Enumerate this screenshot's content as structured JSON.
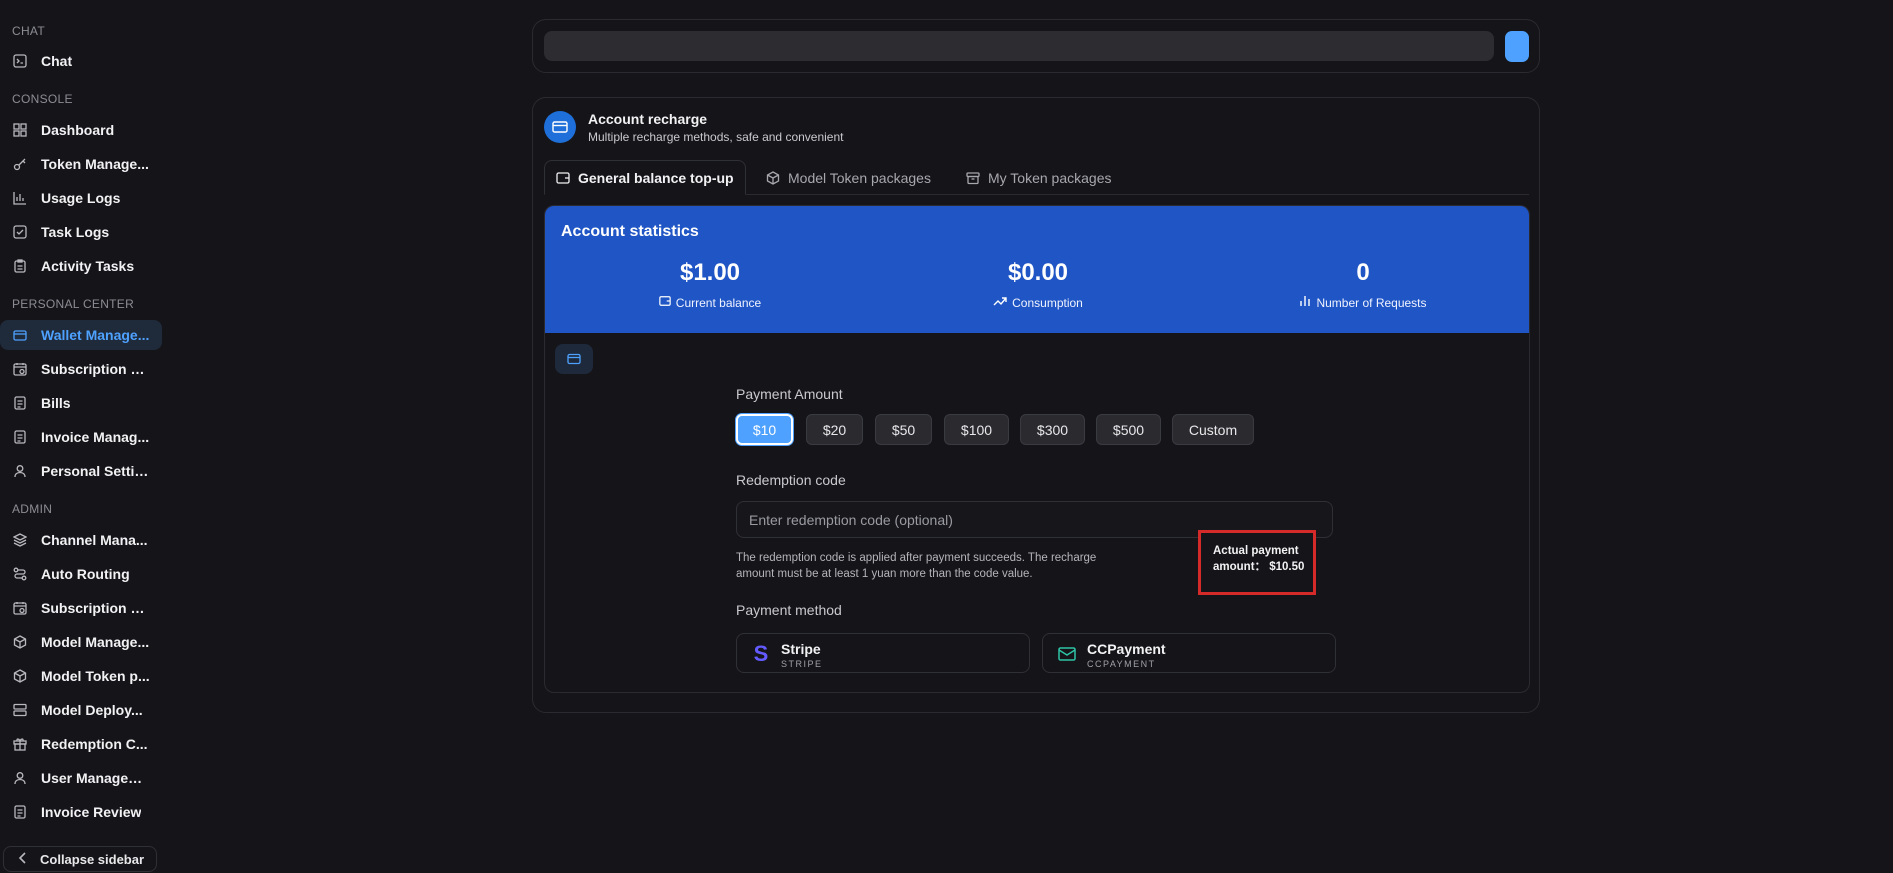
{
  "sidebar": {
    "sections": [
      {
        "title": "CHAT",
        "items": [
          {
            "label": "Chat",
            "icon": "terminal-icon"
          }
        ]
      },
      {
        "title": "CONSOLE",
        "items": [
          {
            "label": "Dashboard",
            "icon": "dashboard-icon"
          },
          {
            "label": "Token Manage...",
            "icon": "key-icon"
          },
          {
            "label": "Usage Logs",
            "icon": "bar-chart-icon"
          },
          {
            "label": "Task Logs",
            "icon": "check-square-icon"
          },
          {
            "label": "Activity Tasks",
            "icon": "clipboard-icon"
          }
        ]
      },
      {
        "title": "PERSONAL CENTER",
        "items": [
          {
            "label": "Wallet Manage...",
            "icon": "credit-card-icon",
            "active": true
          },
          {
            "label": "Subscription Pl...",
            "icon": "calendar-clock-icon"
          },
          {
            "label": "Bills",
            "icon": "document-icon"
          },
          {
            "label": "Invoice Manag...",
            "icon": "document-icon"
          },
          {
            "label": "Personal Settin...",
            "icon": "user-icon"
          }
        ]
      },
      {
        "title": "ADMIN",
        "items": [
          {
            "label": "Channel Mana...",
            "icon": "layers-icon"
          },
          {
            "label": "Auto Routing",
            "icon": "route-icon"
          },
          {
            "label": "Subscription M...",
            "icon": "calendar-clock-icon"
          },
          {
            "label": "Model Manage...",
            "icon": "cube-icon"
          },
          {
            "label": "Model Token p...",
            "icon": "cube-icon"
          },
          {
            "label": "Model Deploy...",
            "icon": "server-icon"
          },
          {
            "label": "Redemption C...",
            "icon": "gift-icon"
          },
          {
            "label": "User Managem...",
            "icon": "user-icon"
          },
          {
            "label": "Invoice Review",
            "icon": "document-icon"
          }
        ]
      }
    ],
    "collapse_label": "Collapse sidebar"
  },
  "recharge": {
    "title": "Account recharge",
    "subtitle": "Multiple recharge methods, safe and convenient",
    "tabs": [
      {
        "label": "General balance top-up",
        "icon": "wallet-icon",
        "active": true
      },
      {
        "label": "Model Token packages",
        "icon": "cube-icon"
      },
      {
        "label": "My Token packages",
        "icon": "archive-icon"
      }
    ],
    "stats": {
      "title": "Account statistics",
      "items": [
        {
          "value": "$1.00",
          "caption": "Current balance",
          "icon": "wallet-icon"
        },
        {
          "value": "$0.00",
          "caption": "Consumption",
          "icon": "trend-up-icon"
        },
        {
          "value": "0",
          "caption": "Number of Requests",
          "icon": "bar-chart-icon"
        }
      ]
    },
    "payment_amount_label": "Payment Amount",
    "amounts": [
      "$10",
      "$20",
      "$50",
      "$100",
      "$300",
      "$500",
      "Custom"
    ],
    "selected_amount": "$10",
    "redemption_label": "Redemption code",
    "redemption_placeholder": "Enter redemption code (optional)",
    "redemption_hint": "The redemption code is applied after payment succeeds. The recharge amount must be at least 1 yuan more than the code value.",
    "actual_payment": "Actual payment amount： $10.50",
    "payment_method_label": "Payment method",
    "methods": [
      {
        "name": "Stripe",
        "code": "STRIPE",
        "color": "#635bff"
      },
      {
        "name": "CCPayment",
        "code": "CCPAYMENT",
        "color": "#2ec4a6"
      }
    ]
  },
  "colors": {
    "accent": "#4ea1ff",
    "stats_bg": "#1f55c4",
    "highlight_border": "#d42a2a"
  }
}
